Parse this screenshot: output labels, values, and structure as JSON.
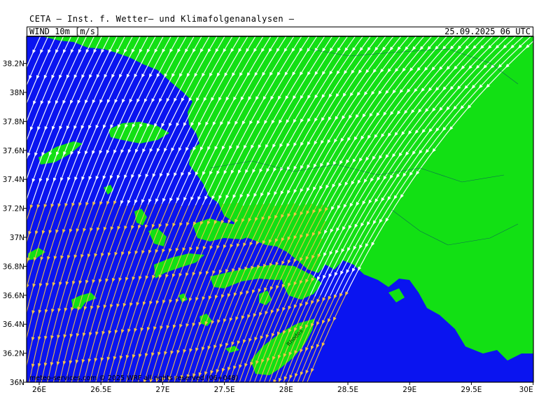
{
  "header": {
    "title": "CETA — Inst. f. Wetter— und Klimafolgenanalysen —",
    "product": "WIND 10m [m/s]",
    "timestamp": "25.09.2025  06  UTC"
  },
  "axes": {
    "lat_labels": [
      "38.2N",
      "38N",
      "37.8N",
      "37.6N",
      "37.4N",
      "37.2N",
      "37N",
      "36.8N",
      "36.6N",
      "36.4N",
      "36.2N",
      "36N"
    ],
    "lon_labels": [
      "26E",
      "26.5E",
      "27E",
      "27.5E",
      "28E",
      "28.5E",
      "29E",
      "29.5E",
      "30E"
    ]
  },
  "footer": {
    "credit": "meteo-services.com  © 2025 WRF  all rights reserved (06+048)"
  },
  "colors": {
    "sea": "#0a14f0",
    "land": "#12e014",
    "streamline_white": "#ffffff",
    "streamline_yellow": "#f2c34a",
    "frame": "#000000"
  },
  "map_labels": {
    "south_city": "Rhodes"
  }
}
